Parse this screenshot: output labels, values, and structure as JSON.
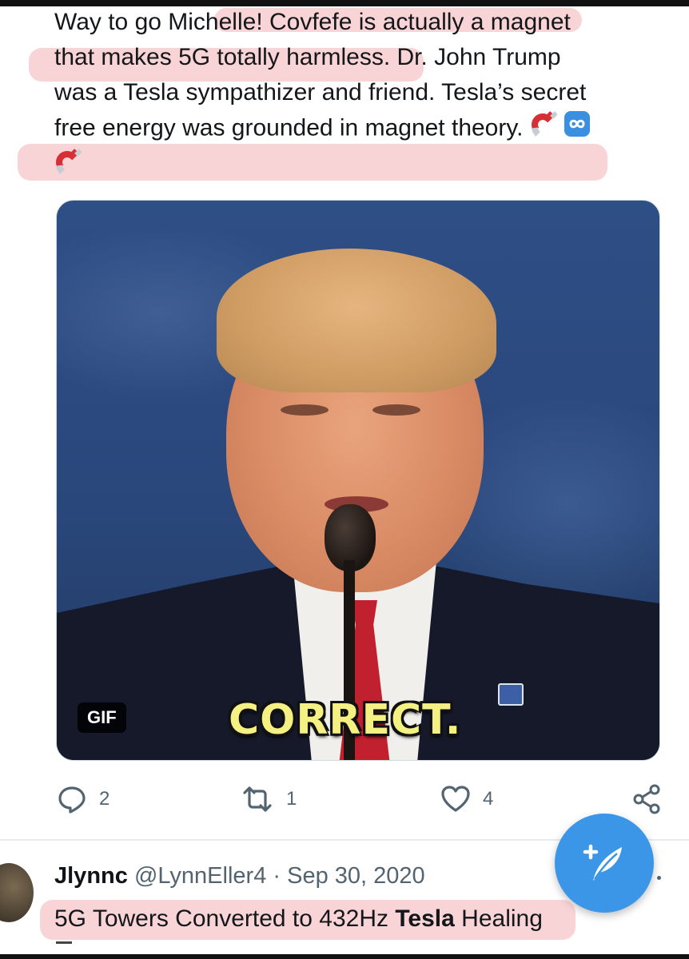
{
  "tweet": {
    "lines": [
      "Way to go Michelle! Covfefe is actually a magnet",
      "that makes 5G totally harmless. Dr. John Trump",
      "was a Tesla sympathizer and friend. Tesla’s secret",
      "free energy was grounded in magnet theory."
    ],
    "trailing_emojis": [
      "magnet-emoji",
      "infinity-emoji",
      "magnet-emoji"
    ]
  },
  "media": {
    "badge": "GIF",
    "caption": "CORRECT."
  },
  "actions": {
    "reply_count": "2",
    "retweet_count": "1",
    "like_count": "4"
  },
  "next_tweet": {
    "name": "Jlynnc",
    "handle": "@LynnEller4",
    "separator": "·",
    "date": "Sep 30, 2020",
    "text_before": "5G Towers Converted to 432Hz ",
    "text_bold": "Tesla",
    "text_after": " Healing"
  },
  "colors": {
    "accent": "#3c96e8",
    "highlight": "#eb7882",
    "text": "#14171a",
    "muted": "#536471"
  }
}
